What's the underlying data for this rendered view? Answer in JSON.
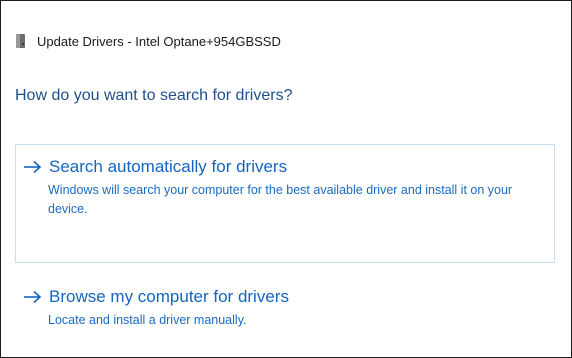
{
  "window": {
    "title": "Update Drivers - Intel Optane+954GBSSD",
    "icon": "drive-icon"
  },
  "question": "How do you want to search for drivers?",
  "options": [
    {
      "icon": "arrow-right-icon",
      "title": "Search automatically for drivers",
      "description": "Windows will search your computer for the best available driver and install it on your device.",
      "selected": true
    },
    {
      "icon": "arrow-right-icon",
      "title": "Browse my computer for drivers",
      "description": "Locate and install a driver manually.",
      "selected": false
    }
  ],
  "colors": {
    "heading": "#1f4f8a",
    "link": "#1565c0",
    "description": "#1a6bc0",
    "selection_border": "#c8dff1"
  }
}
